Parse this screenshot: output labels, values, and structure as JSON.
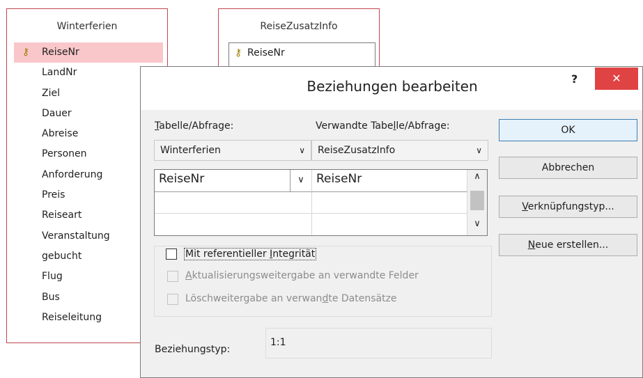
{
  "winterferien": {
    "title": "Winterferien",
    "fields": [
      "ReiseNr",
      "LandNr",
      "Ziel",
      "Dauer",
      "Abreise",
      "Personen",
      "Anforderung",
      "Preis",
      "Reiseart",
      "Veranstaltung",
      "gebucht",
      "Flug",
      "Bus",
      "Reiseleitung"
    ]
  },
  "reisezusatz": {
    "title": "ReiseZusatzInfo",
    "fields": [
      "ReiseNr"
    ]
  },
  "dialog": {
    "title": "Beziehungen bearbeiten",
    "help_label": "?",
    "close_label": "✕",
    "left_label_u": "T",
    "left_label_rest": "abelle/Abfrage:",
    "right_label_a": "Verwandte Tabe",
    "right_label_u": "l",
    "right_label_b": "le/Abfrage:",
    "left_combo": "Winterferien",
    "right_combo": "ReiseZusatzInfo",
    "grid_left": "ReiseNr",
    "grid_right": "ReiseNr",
    "ok": "OK",
    "cancel": "Abbrechen",
    "join_u": "V",
    "join_rest": "erknüpfungstyp...",
    "new_u": "N",
    "new_rest": "eue erstellen...",
    "integrity_a": "Mit referentieller ",
    "integrity_u": "I",
    "integrity_b": "ntegrität",
    "cascade_update_u": "A",
    "cascade_update_rest": "ktualisierungsweitergabe an verwandte Felder",
    "cascade_delete_a": "Löschweitergabe an verwan",
    "cascade_delete_u": "d",
    "cascade_delete_b": "te Datensätze",
    "reltype_label": "Beziehungstyp:",
    "reltype_value": "1:1"
  }
}
